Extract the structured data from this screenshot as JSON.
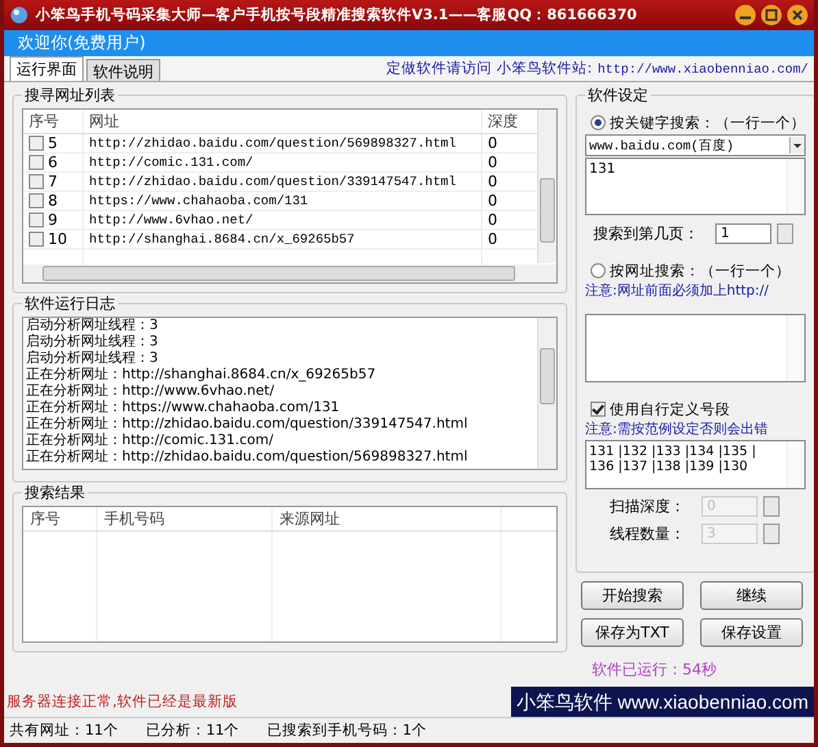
{
  "window": {
    "title": "小笨鸟手机号码采集大师—客户手机按号段精准搜索软件V3.1——客服QQ：861666370"
  },
  "welcome": "欢迎你(免费用户)",
  "tabs": [
    {
      "label": "运行界面",
      "selected": true
    },
    {
      "label": "软件说明",
      "selected": false
    }
  ],
  "header_link": {
    "label": "定做软件请访问 小笨鸟软件站:",
    "url": "http://www.xiaobenniao.com/"
  },
  "url_list": {
    "title": "搜寻网址列表",
    "columns": [
      "序号",
      "网址",
      "深度"
    ],
    "rows": [
      {
        "checked": false,
        "index": "5",
        "url": "http://zhidao.baidu.com/question/569898327.html",
        "depth": "0"
      },
      {
        "checked": false,
        "index": "6",
        "url": "http://comic.131.com/",
        "depth": "0"
      },
      {
        "checked": false,
        "index": "7",
        "url": "http://zhidao.baidu.com/question/339147547.html",
        "depth": "0"
      },
      {
        "checked": false,
        "index": "8",
        "url": "https://www.chahaoba.com/131",
        "depth": "0"
      },
      {
        "checked": false,
        "index": "9",
        "url": "http://www.6vhao.net/",
        "depth": "0"
      },
      {
        "checked": false,
        "index": "10",
        "url": "http://shanghai.8684.cn/x_69265b57",
        "depth": "0"
      }
    ]
  },
  "log": {
    "title": "软件运行日志",
    "lines": [
      "启动分析网址线程：3",
      "启动分析网址线程：3",
      "启动分析网址线程：3",
      "正在分析网址：http://shanghai.8684.cn/x_69265b57",
      "正在分析网址：http://www.6vhao.net/",
      "正在分析网址：https://www.chahaoba.com/131",
      "正在分析网址：http://zhidao.baidu.com/question/339147547.html",
      "正在分析网址：http://comic.131.com/",
      "正在分析网址：http://zhidao.baidu.com/question/569898327.html"
    ]
  },
  "results": {
    "title": "搜索结果",
    "columns": [
      "序号",
      "手机号码",
      "来源网址"
    ]
  },
  "settings": {
    "title": "软件设定",
    "keyword_search": {
      "label": "按关键字搜索：（一行一个）",
      "selected": true
    },
    "engine": "www.baidu.com(百度)",
    "keywords": "131",
    "page_label": "搜索到第几页：",
    "page_value": "1",
    "url_search": {
      "label": "按网址搜索：（一行一个）",
      "selected": false
    },
    "url_note": "注意:网址前面必须加上http://",
    "custom": {
      "label": "使用自行定义号段",
      "checked": true
    },
    "custom_note": "注意:需按范例设定否则会出错",
    "segments": [
      "131 |132 |133 |134 |135 |",
      "136 |137 |138 |139 |130"
    ],
    "scan_depth": {
      "label": "扫描深度：",
      "value": "0",
      "disabled": true
    },
    "threads": {
      "label": "线程数量：",
      "value": "3",
      "disabled": true
    }
  },
  "buttons": [
    "开始搜索",
    "继续",
    "保存为TXT",
    "保存设置"
  ],
  "runtime": "软件已运行：54秒",
  "server_status": "服务器连接正常,软件已经是最新版",
  "banner": "小笨鸟软件 www.xiaobenniao.com",
  "status_bar": [
    "共有网址：11个",
    "已分析：11个",
    "已搜索到手机号码：1个"
  ]
}
